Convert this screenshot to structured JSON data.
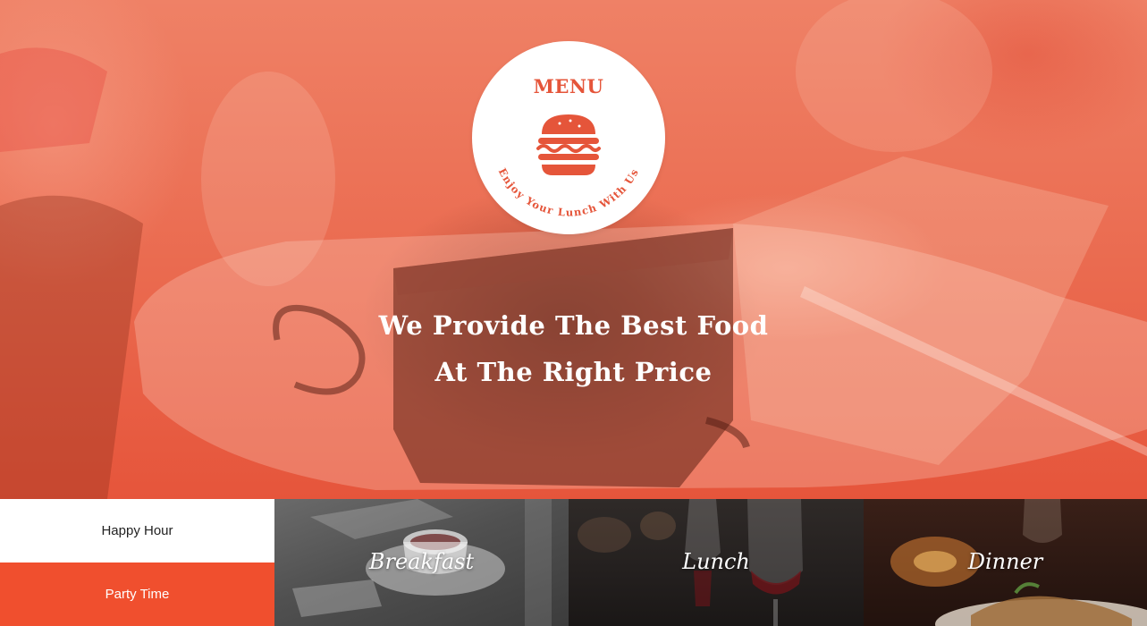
{
  "hero": {
    "badge": {
      "title": "MENU",
      "tagline": "Enjoy Your Lunch With Us",
      "icon": "burger-icon"
    },
    "headline_line1": "We Provide The Best Food",
    "headline_line2_regular": "At The ",
    "headline_line2_strong": "Right Price"
  },
  "tabs": [
    {
      "label": "Happy Hour",
      "active": false
    },
    {
      "label": "Party Time",
      "active": true
    }
  ],
  "tiles": [
    {
      "label": "Breakfast"
    },
    {
      "label": "Lunch"
    },
    {
      "label": "Dinner"
    }
  ],
  "colors": {
    "accent": "#f04f2e",
    "badge_text": "#e5553a",
    "hero_overlay": "#ea6a4f"
  }
}
